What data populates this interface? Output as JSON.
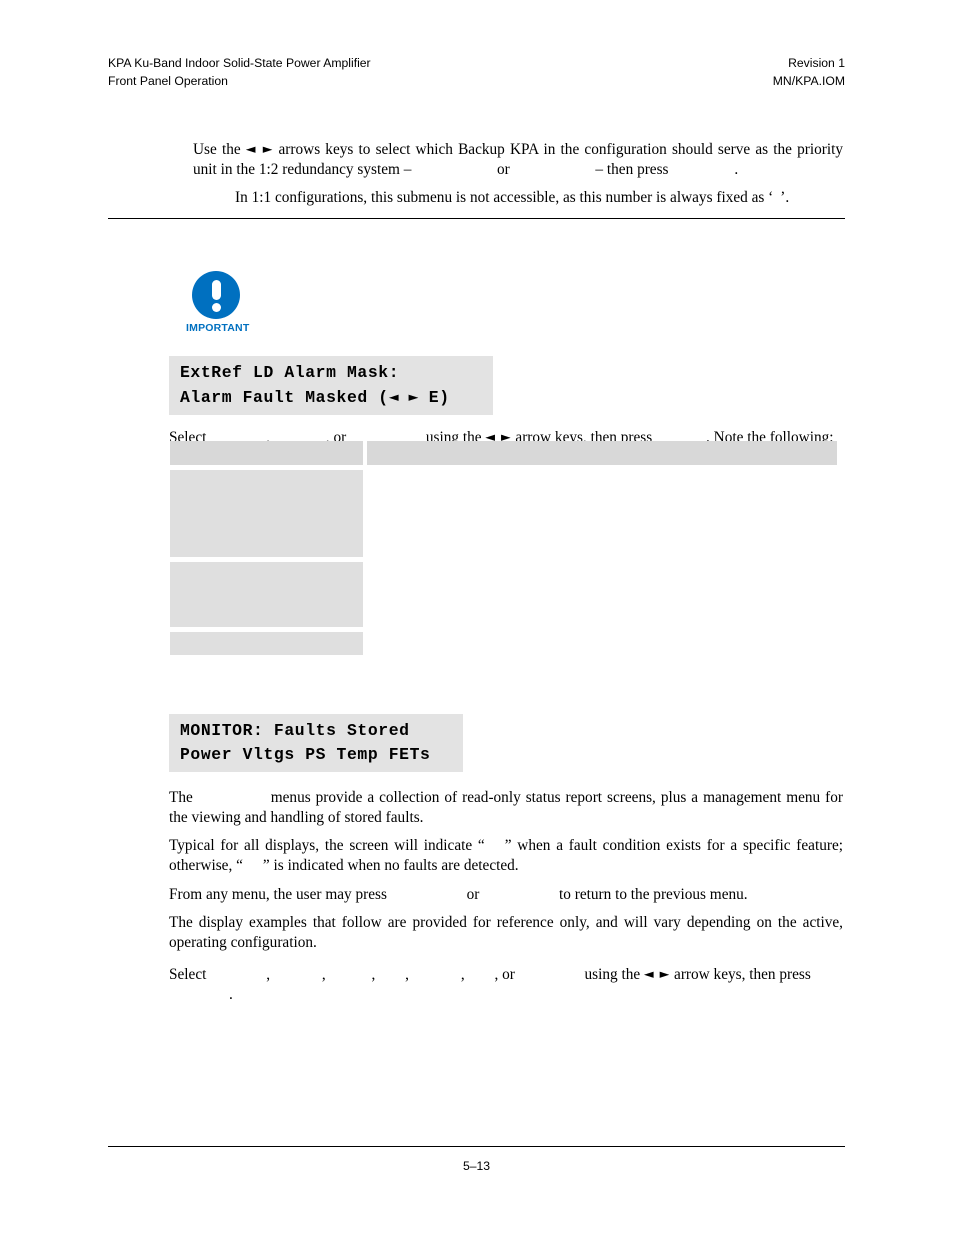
{
  "header": {
    "left_line_1": "KPA Ku-Band Indoor Solid-State Power Amplifier",
    "left_line_2": "Front Panel Operation",
    "right_line_1": "Revision 1",
    "right_line_2": "MN/KPA.IOM"
  },
  "intro": {
    "para_text_1": "Use the ",
    "arrows": "◄ ►",
    "para_text_2": " arrows keys to select which Backup KPA in the configuration should serve as the priority unit in the 1:2 redundancy system – ",
    "kw_option_1": "",
    "para_text_3": " or ",
    "kw_option_2": "",
    "para_text_4": " – then press ",
    "kw_enter": "",
    "para_text_5": ".",
    "note_text_1": "In 1:1 configurations, this submenu is not accessible, as this number is always fixed as ‘",
    "note_kw": "",
    "note_text_2": "’."
  },
  "important": {
    "label": "IMPORTANT",
    "icon": "exclamation-circle-icon",
    "color": "#0070c0"
  },
  "lcd_extref": {
    "line_1": "ExtRef LD Alarm Mask:",
    "line_2_pre": "Alarm Fault Masked (",
    "line_2_arrows": "◄ ►",
    "line_2_post": " E)"
  },
  "select_line_1": {
    "text_1": "Select ",
    "kw_1": "",
    "text_2": ", ",
    "kw_2": "",
    "text_3": ", or ",
    "kw_3": "",
    "text_4": " using the ",
    "arrows": "◄ ►",
    "text_5": " arrow keys, then press ",
    "kw_enter": "",
    "text_6": ". Note the following:"
  },
  "mask_table": {
    "rows": [
      {
        "is_header": true,
        "height_class": "h-header",
        "left": "",
        "right": "",
        "right_blank": false
      },
      {
        "is_header": false,
        "height_class": "h-tall",
        "left": "",
        "right": "",
        "right_blank": true
      },
      {
        "is_header": false,
        "height_class": "h-mid",
        "left": "",
        "right": "",
        "right_blank": true
      },
      {
        "is_header": false,
        "height_class": "h-short",
        "left": "",
        "right": "",
        "right_blank": true
      }
    ]
  },
  "lcd_monitor": {
    "line_1": "MONITOR: Faults Stored",
    "line_2": "Power Vltgs PS Temp FETs"
  },
  "monitor": {
    "para_1_text_1": "The ",
    "para_1_kw": "",
    "para_1_text_2": " menus provide a collection of read-only status report screens, plus a management menu for the viewing and handling of stored faults.",
    "para_2_text_1": "Typical for all displays, the screen will indicate “",
    "para_2_kw_1": "",
    "para_2_text_2": "” when a fault condition exists for a specific feature; otherwise, “",
    "para_2_kw_2": "",
    "para_2_text_3": "” is indicated when no faults are detected.",
    "para_3_text_1": "From any menu, the user may press ",
    "para_3_kw_1": "",
    "para_3_text_2": " or ",
    "para_3_kw_2": "",
    "para_3_text_3": " to return to the previous menu.",
    "para_4_text": "The display examples that follow are provided for reference only, and will vary depending on the active, operating configuration.",
    "para_5_text_1": "Select ",
    "para_5_kw_1": "",
    "para_5_text_2": ", ",
    "para_5_kw_2": "",
    "para_5_text_3": ", ",
    "para_5_kw_3": "",
    "para_5_text_4": ", ",
    "para_5_kw_4": "",
    "para_5_text_5": ", ",
    "para_5_kw_5": "",
    "para_5_text_6": ", ",
    "para_5_kw_6": "",
    "para_5_text_7": ", or ",
    "para_5_kw_7": "",
    "para_5_text_8": " using the ",
    "para_5_arrows": "◄ ►",
    "para_5_text_9": " arrow keys, then press ",
    "para_5_kw_enter": "",
    "para_5_text_10": "."
  },
  "footer": {
    "page_number": "5–13"
  }
}
